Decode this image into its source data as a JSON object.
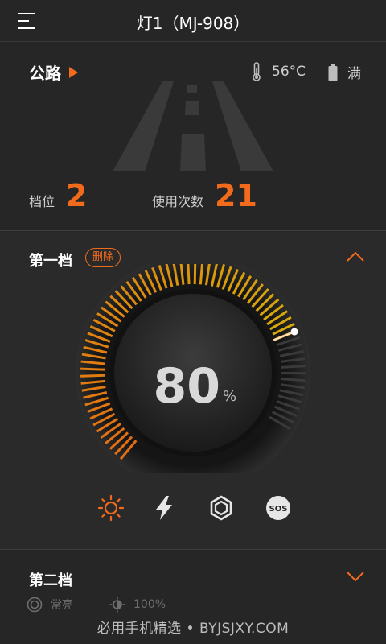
{
  "header": {
    "title": "灯1（MJ-908）"
  },
  "status": {
    "mode": "公路",
    "temperature": "56°C",
    "battery": "满",
    "gear_label": "档位",
    "gear_value": "2",
    "uses_label": "使用次数",
    "uses_value": "21"
  },
  "gear1": {
    "title": "第一档",
    "delete_label": "删除",
    "brightness_value": "80",
    "brightness_unit": "%",
    "brightness_level": 0.8,
    "modes": [
      "sun-icon",
      "lightning-icon",
      "hexagon-icon",
      "sos-icon"
    ],
    "selected_mode": "sun-icon",
    "sos_text": "SOS"
  },
  "gear2": {
    "title": "第二档",
    "mode_label": "常亮",
    "brightness": "100%"
  },
  "watermark": "必用手机精选 • BYJSJXY.COM",
  "colors": {
    "accent": "#f26a1b",
    "background": "#262626",
    "panel": "#2a2a2a"
  }
}
